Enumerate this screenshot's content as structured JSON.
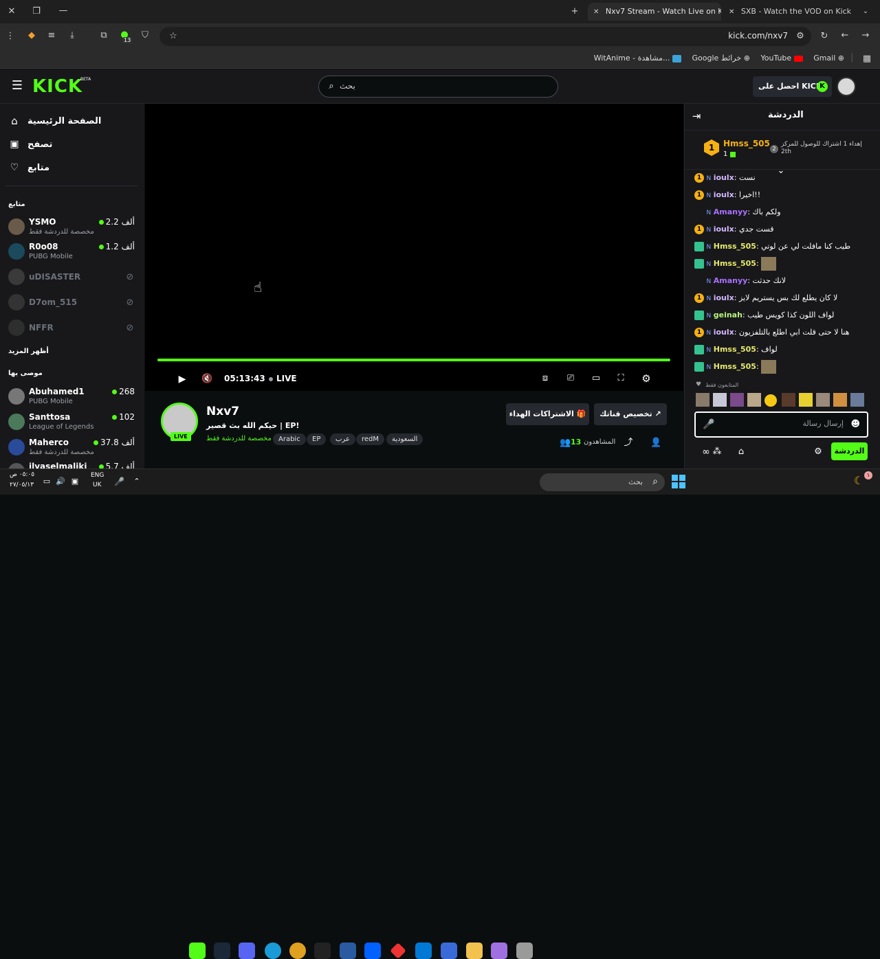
{
  "browser": {
    "tabs": [
      {
        "title": "Nxv7 Stream - Watch Live on Ki",
        "active": true
      },
      {
        "title": "SXB - Watch the VOD on Kick",
        "active": false
      }
    ],
    "url": "kick.com/nxv7",
    "extension_badge": "13",
    "bookmarks": [
      "Gmail",
      "YouTube",
      "Google خرائط",
      "WitAnime - مشاهدة..."
    ]
  },
  "site": {
    "logo": "KICK",
    "logo_tag": "BETA",
    "search_placeholder": "بحث",
    "get_kicks": "احصل على KICKs"
  },
  "leftnav": {
    "home": "الصفحة الرئيسية",
    "browse": "تصفح",
    "following": "متابع",
    "following_section": "متابع",
    "followed": [
      {
        "name": "YSMO",
        "sub": "مخصصة للدردشة فقط",
        "count": "2.2 ألف",
        "live": true
      },
      {
        "name": "R0o08",
        "sub": "PUBG Mobile",
        "count": "1.2 ألف",
        "live": true
      },
      {
        "name": "uDISASTER",
        "sub": "",
        "count": "",
        "live": false
      },
      {
        "name": "D7om_515",
        "sub": "",
        "count": "",
        "live": false
      },
      {
        "name": "NFFR",
        "sub": "",
        "count": "",
        "live": false
      }
    ],
    "show_more": "أظهر المزيد",
    "recommended_section": "موصى بها",
    "recommended": [
      {
        "name": "Abuhamed1",
        "sub": "PUBG Mobile",
        "count": "268"
      },
      {
        "name": "Santtosa",
        "sub": "League of Legends",
        "count": "102"
      },
      {
        "name": "Maherco",
        "sub": "مخصصة للدردشة فقط",
        "count": "37.8 ألف"
      },
      {
        "name": "ilyaselmaliki",
        "sub": "",
        "count": "5.7 ألف"
      }
    ]
  },
  "player": {
    "time": "05:13:43",
    "live_label": "LIVE",
    "progress": 1.0
  },
  "stream": {
    "channel": "Nxv7",
    "title": "حيكم الله بث قصير | EP!",
    "category": "مخصصة للدردشة فقط",
    "live_badge": "LIVE",
    "tags": [
      "السعودية",
      "redM",
      "عرب",
      "EP",
      "Arabic"
    ],
    "viewers_label": "المشاهدون",
    "viewers": "13",
    "gift_subs": "الاشتراكات الهداء",
    "customize": "تخصيص قناتك"
  },
  "chat": {
    "title": "الدردشة",
    "pinned_user": "Hmss_505",
    "pinned_count": "1",
    "pinned_text": "إهداء 1 اشتراك للوصول للمركز",
    "pinned_rank": "2th",
    "messages": [
      {
        "user": "ioulx",
        "text": "نست",
        "badge": "gold",
        "color": "#d5b8ff"
      },
      {
        "user": "ioulx",
        "text": "اخيرا!!",
        "badge": "gold",
        "color": "#d5b8ff"
      },
      {
        "user": "Amanyy",
        "text": "ولكم باك",
        "badge": "none",
        "color": "#a970ff"
      },
      {
        "user": "ioulx",
        "text": "قست جدي",
        "badge": "gold",
        "color": "#d5b8ff"
      },
      {
        "user": "Hmss_505",
        "text": "طيب كنا مافلت لي عن لوتي",
        "badge": "green",
        "color": "#e6e96a"
      },
      {
        "user": "Hmss_505",
        "text": "",
        "badge": "green",
        "color": "#e6e96a"
      },
      {
        "user": "Amanyy",
        "text": "لانك حدثت",
        "badge": "none",
        "color": "#a970ff"
      },
      {
        "user": "ioulx",
        "text": "لا كان يطلع لك بس يستريم لايز",
        "badge": "gold",
        "color": "#d5b8ff"
      },
      {
        "user": "geinah",
        "text": "لواف اللون كذا كويس طيب",
        "badge": "green",
        "color": "#b9f57a"
      },
      {
        "user": "ioulx",
        "text": "هنا لا حتى قلت ابي اطلع بالتلفزيون",
        "badge": "gold",
        "color": "#d5b8ff"
      },
      {
        "user": "Hmss_505",
        "text": "لواف",
        "badge": "green",
        "color": "#e6e96a"
      },
      {
        "user": "Hmss_505",
        "text": "",
        "badge": "green",
        "color": "#e6e96a"
      }
    ],
    "followers_only": "المتابعون فقط",
    "input_placeholder": "إرسال رسالة",
    "send_label": "الدردشة"
  },
  "taskbar": {
    "search": "بحث",
    "lang": "ENG",
    "region": "UK",
    "time": "٠٥:٠٥ ص",
    "date": "٢٧/٠٥/١٣",
    "notif": "١"
  },
  "colors": {
    "accent": "#53fc18",
    "bg": "#0b0e0f",
    "panel": "#18181b"
  }
}
